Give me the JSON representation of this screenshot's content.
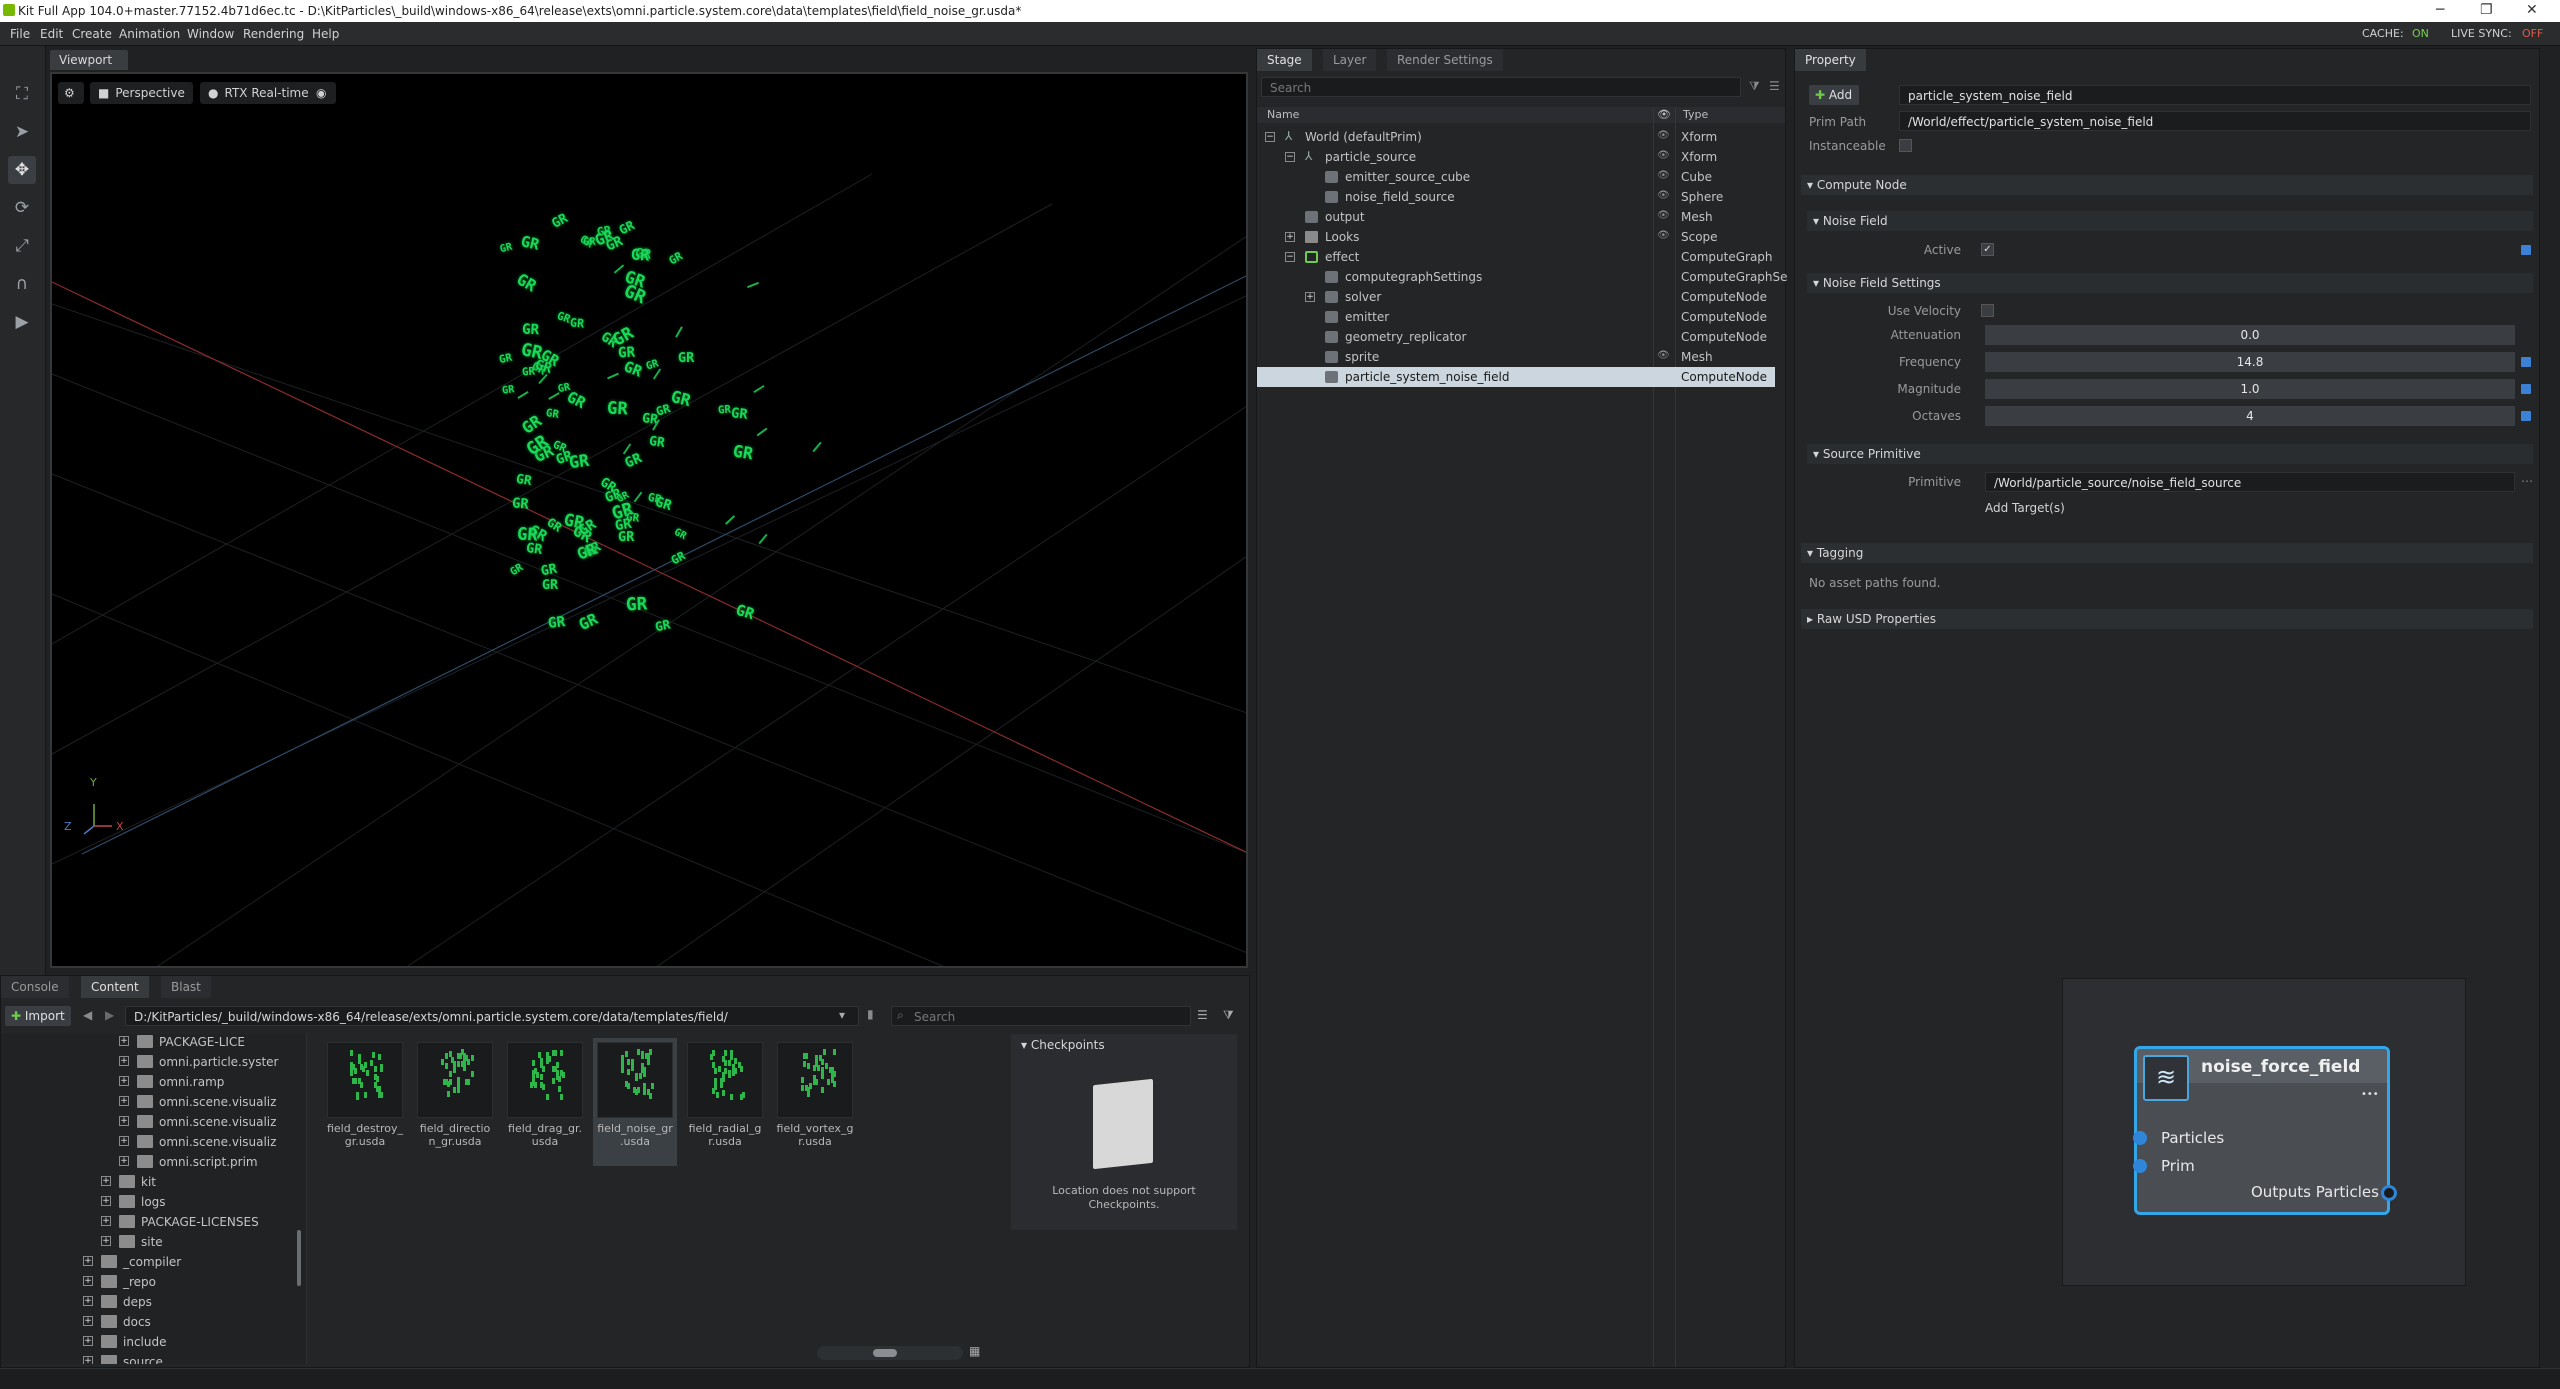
{
  "titlebar": {
    "title": "Kit Full App 104.0+master.77152.4b71d6ec.tc - D:\\KitParticles\\_build\\windows-x86_64\\release\\exts\\omni.particle.system.core\\data\\templates\\field\\field_noise_gr.usda*",
    "minimize": "─",
    "maximize": "❐",
    "close": "✕"
  },
  "menubar": {
    "items": [
      "File",
      "Edit",
      "Create",
      "Animation",
      "Window",
      "Rendering",
      "Help"
    ],
    "cache_label": "CACHE:",
    "cache_value": "ON",
    "livesync_label": "LIVE SYNC:",
    "livesync_value": "OFF"
  },
  "colors": {
    "accent_blue": "#33a7e8",
    "cache_on": "#76d04a",
    "livesync_off": "#e05a4a",
    "particle_green": "#19d85a",
    "selection": "#ccd6df"
  },
  "viewport": {
    "tab": "Viewport",
    "settings_icon": "gear-icon",
    "camera_label": "Perspective",
    "render_label": "RTX Real-time",
    "visibility_icon": "eye-icon",
    "axis_y": "Y",
    "axis_x": "X",
    "axis_z": "Z",
    "particle_glyph": "GR"
  },
  "stage": {
    "tabs": [
      "Stage",
      "Layer",
      "Render Settings"
    ],
    "search_placeholder": "Search",
    "col_name": "Name",
    "col_type": "Type",
    "rows": [
      {
        "name": "World (defaultPrim)",
        "type": "Xform"
      },
      {
        "name": "particle_source",
        "type": "Xform"
      },
      {
        "name": "emitter_source_cube",
        "type": "Cube"
      },
      {
        "name": "noise_field_source",
        "type": "Sphere"
      },
      {
        "name": "output",
        "type": "Mesh"
      },
      {
        "name": "Looks",
        "type": "Scope"
      },
      {
        "name": "effect",
        "type": "ComputeGraph"
      },
      {
        "name": "computegraphSettings",
        "type": "ComputeGraphSe"
      },
      {
        "name": "solver",
        "type": "ComputeNode"
      },
      {
        "name": "emitter",
        "type": "ComputeNode"
      },
      {
        "name": "geometry_replicator",
        "type": "ComputeNode"
      },
      {
        "name": "sprite",
        "type": "Mesh"
      },
      {
        "name": "particle_system_noise_field",
        "type": "ComputeNode"
      }
    ]
  },
  "property": {
    "tab": "Property",
    "add_label": "Add",
    "prim_name": "particle_system_noise_field",
    "prim_path_label": "Prim Path",
    "prim_path": "/World/effect/particle_system_noise_field",
    "instanceable_label": "Instanceable",
    "compute_node": "Compute Node",
    "noise_field": "Noise Field",
    "active_label": "Active",
    "noise_field_settings": "Noise Field Settings",
    "use_velocity_label": "Use Velocity",
    "attenuation_label": "Attenuation",
    "attenuation": "0.0",
    "frequency_label": "Frequency",
    "frequency": "14.8",
    "magnitude_label": "Magnitude",
    "magnitude": "1.0",
    "octaves_label": "Octaves",
    "octaves": "4",
    "source_primitive": "Source Primitive",
    "primitive_label": "Primitive",
    "primitive": "/World/particle_source/noise_field_source",
    "add_targets": "Add Target(s)",
    "tagging": "Tagging",
    "no_assets": "No asset paths found.",
    "raw_usd": "Raw USD Properties"
  },
  "content": {
    "tabs": [
      "Console",
      "Content",
      "Blast"
    ],
    "import_label": "Import",
    "path": "D:/KitParticles/_build/windows-x86_64/release/exts/omni.particle.system.core/data/templates/field/",
    "search_placeholder": "Search",
    "tree": [
      "PACKAGE-LICE",
      "omni.particle.syster",
      "omni.ramp",
      "omni.scene.visualiz",
      "omni.scene.visualiz",
      "omni.scene.visualiz",
      "omni.script.prim",
      "kit",
      "logs",
      "PACKAGE-LICENSES",
      "site",
      "_compiler",
      "_repo",
      "deps",
      "docs",
      "include",
      "source"
    ],
    "files": [
      {
        "line1": "field_destroy_",
        "line2": "gr.usda"
      },
      {
        "line1": "field_directio",
        "line2": "n_gr.usda"
      },
      {
        "line1": "field_drag_gr.",
        "line2": "usda"
      },
      {
        "line1": "field_noise_gr",
        "line2": ".usda"
      },
      {
        "line1": "field_radial_g",
        "line2": "r.usda"
      },
      {
        "line1": "field_vortex_g",
        "line2": "r.usda"
      }
    ],
    "checkpoints_title": "Checkpoints",
    "checkpoints_msg1": "Location does not support",
    "checkpoints_msg2": "Checkpoints."
  },
  "node": {
    "title": "noise_force_field",
    "menu": "•••",
    "in1": "Particles",
    "in2": "Prim",
    "out1": "Outputs Particles"
  }
}
